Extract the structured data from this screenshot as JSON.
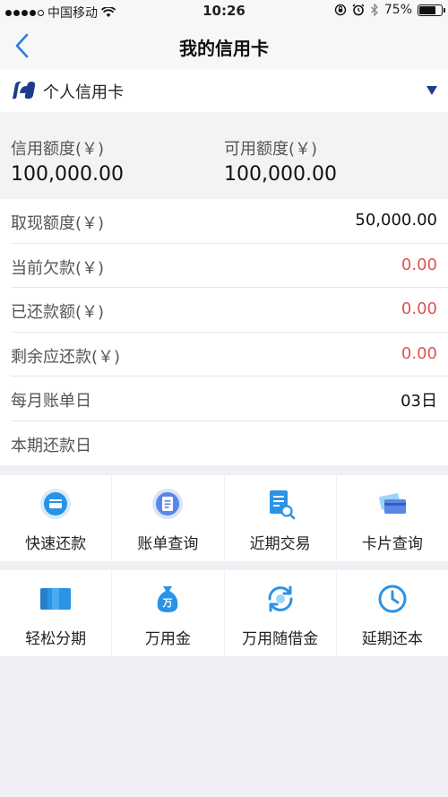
{
  "status_bar": {
    "carrier": "中国移动",
    "time": "10:26",
    "battery": "75%",
    "battery_level": 0.75
  },
  "nav": {
    "title": "我的信用卡"
  },
  "card_selector": {
    "label": "个人信用卡"
  },
  "limits": {
    "credit_label": "信用额度(￥)",
    "credit_value": "100,000.00",
    "available_label": "可用额度(￥)",
    "available_value": "100,000.00"
  },
  "details": [
    {
      "label": "取现额度(￥)",
      "value": "50,000.00"
    },
    {
      "label": "当前欠款(￥)",
      "value": "0.00"
    },
    {
      "label": "已还款额(￥)",
      "value": "0.00"
    },
    {
      "label": "剩余应还款(￥)",
      "value": "0.00"
    },
    {
      "label": "每月账单日",
      "value": "03日"
    },
    {
      "label": "本期还款日",
      "value": ""
    }
  ],
  "actions": [
    {
      "label": "快速还款",
      "icon": "card-payment-icon"
    },
    {
      "label": "账单查询",
      "icon": "bill-icon"
    },
    {
      "label": "近期交易",
      "icon": "transaction-search-icon"
    },
    {
      "label": "卡片查询",
      "icon": "cards-icon"
    },
    {
      "label": "轻松分期",
      "icon": "installment-icon"
    },
    {
      "label": "万用金",
      "icon": "money-bag-icon"
    },
    {
      "label": "万用随借金",
      "icon": "cycle-loan-icon"
    },
    {
      "label": "延期还本",
      "icon": "clock-icon"
    }
  ],
  "colors": {
    "accent_blue": "#2a93e6",
    "red": "#e05252",
    "logo_blue": "#1e3c8c"
  }
}
